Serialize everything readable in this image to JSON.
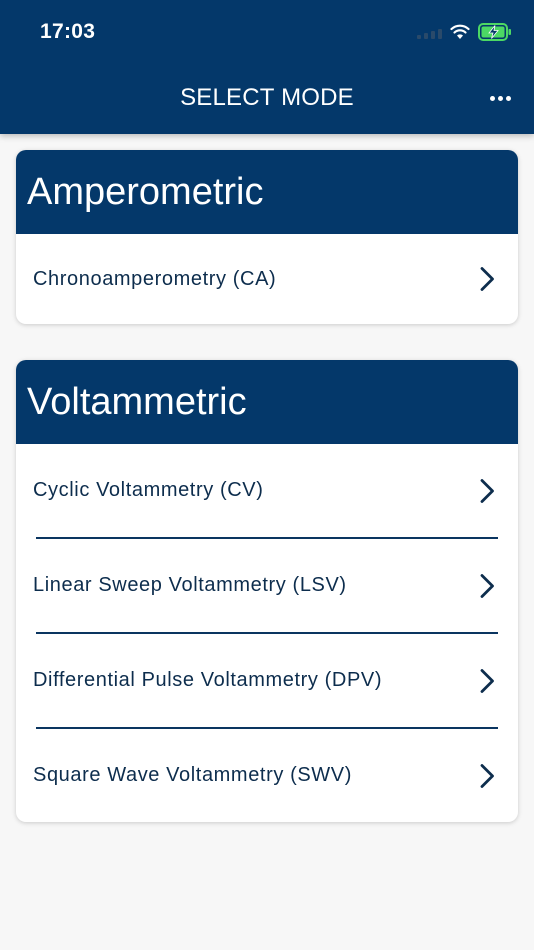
{
  "status_bar": {
    "time": "17:03",
    "icons": [
      "cellular-signal-icon",
      "wifi-icon",
      "battery-charging-icon"
    ]
  },
  "nav": {
    "title": "SELECT MODE",
    "menu_icon": "more-horizontal-icon"
  },
  "colors": {
    "primary": "#04386a",
    "row_text": "#0d2d4d",
    "background": "#f7f7f7",
    "battery": "#4cd964"
  },
  "sections": [
    {
      "title": "Amperometric",
      "items": [
        {
          "label": "Chronoamperometry (CA)"
        }
      ]
    },
    {
      "title": "Voltammetric",
      "items": [
        {
          "label": "Cyclic Voltammetry (CV)"
        },
        {
          "label": "Linear Sweep Voltammetry (LSV)"
        },
        {
          "label": "Differential Pulse Voltammetry (DPV)"
        },
        {
          "label": "Square Wave Voltammetry (SWV)"
        }
      ]
    }
  ]
}
